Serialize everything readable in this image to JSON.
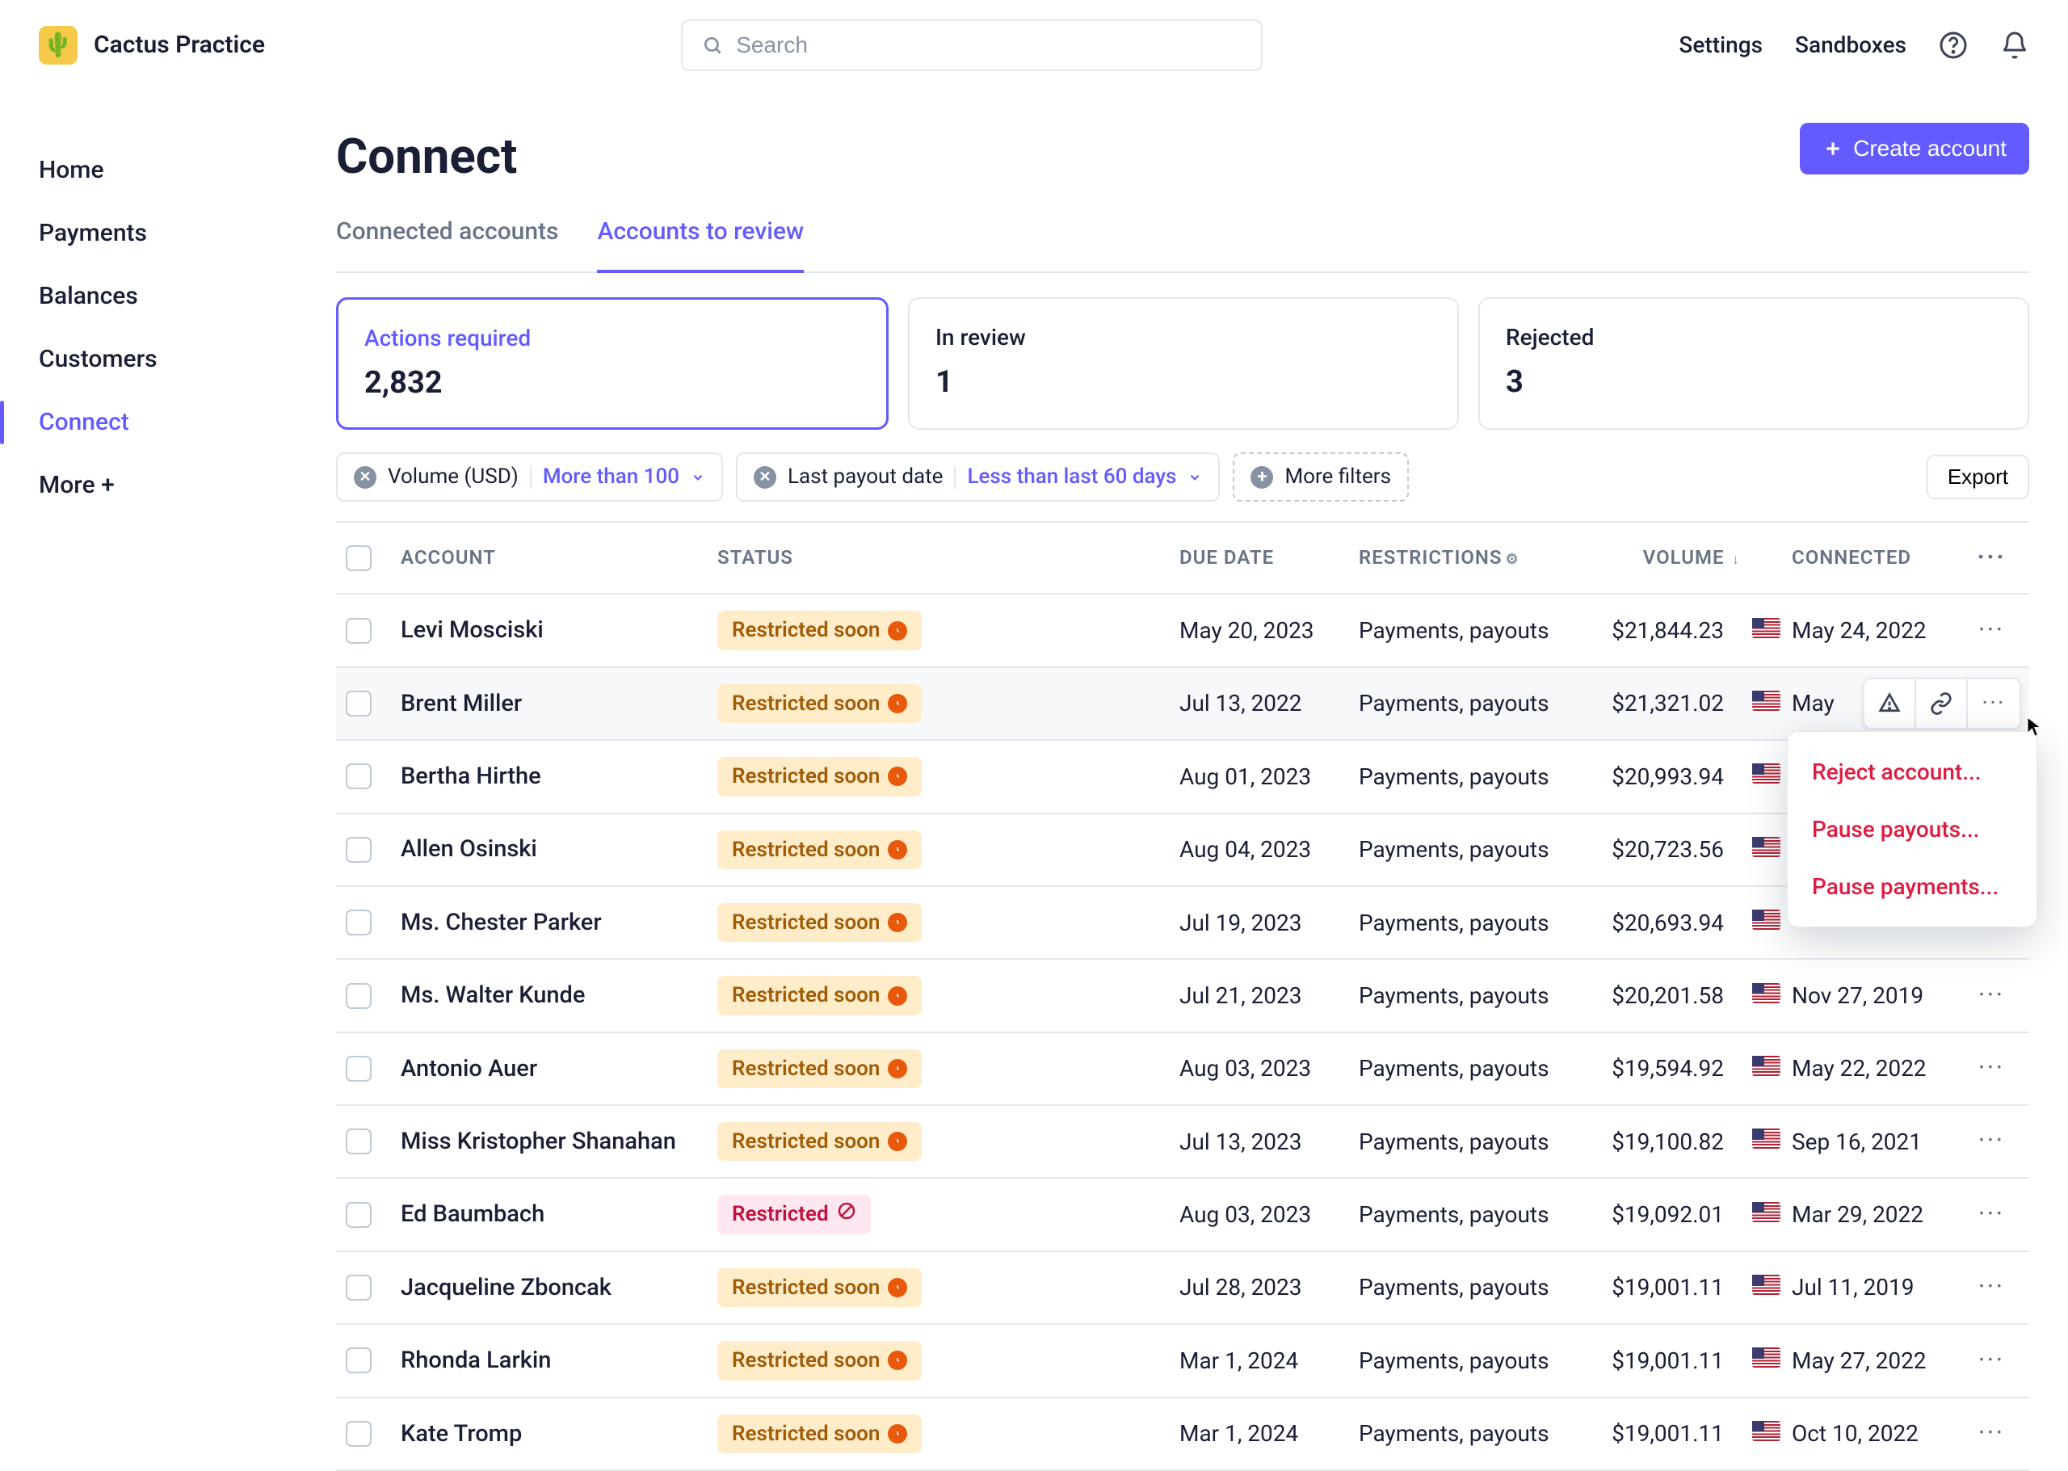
{
  "brand": "Cactus Practice",
  "search": {
    "placeholder": "Search"
  },
  "header_links": {
    "settings": "Settings",
    "sandboxes": "Sandboxes"
  },
  "sidebar": {
    "items": [
      {
        "label": "Home"
      },
      {
        "label": "Payments"
      },
      {
        "label": "Balances"
      },
      {
        "label": "Customers"
      },
      {
        "label": "Connect"
      },
      {
        "label": "More  +"
      }
    ],
    "active_index": 4
  },
  "page": {
    "title": "Connect",
    "create_button": "Create account"
  },
  "tabs": {
    "items": [
      {
        "label": "Connected accounts"
      },
      {
        "label": "Accounts to review"
      }
    ],
    "active_index": 1
  },
  "cards": {
    "items": [
      {
        "label": "Actions required",
        "value": "2,832"
      },
      {
        "label": "In review",
        "value": "1"
      },
      {
        "label": "Rejected",
        "value": "3"
      }
    ],
    "active_index": 0
  },
  "filters": {
    "chips": [
      {
        "label": "Volume (USD)",
        "value": "More than 100"
      },
      {
        "label": "Last payout date",
        "value": "Less than last 60 days"
      }
    ],
    "more": "More filters",
    "export": "Export"
  },
  "columns": {
    "account": "ACCOUNT",
    "status": "STATUS",
    "due_date": "DUE DATE",
    "restrictions": "RESTRICTIONS",
    "volume": "VOLUME",
    "connected": "CONNECTED"
  },
  "status_labels": {
    "soon": "Restricted soon",
    "restricted": "Restricted"
  },
  "rows": [
    {
      "name": "Levi Mosciski",
      "status": "soon",
      "due": "May 20, 2023",
      "restr": "Payments, payouts",
      "vol": "$21,844.23",
      "conn": "May 24, 2022"
    },
    {
      "name": "Brent Miller",
      "status": "soon",
      "due": "Jul 13, 2022",
      "restr": "Payments, payouts",
      "vol": "$21,321.02",
      "conn": "May"
    },
    {
      "name": "Bertha Hirthe",
      "status": "soon",
      "due": "Aug 01, 2023",
      "restr": "Payments, payouts",
      "vol": "$20,993.94",
      "conn": ""
    },
    {
      "name": "Allen Osinski",
      "status": "soon",
      "due": "Aug 04, 2023",
      "restr": "Payments, payouts",
      "vol": "$20,723.56",
      "conn": ""
    },
    {
      "name": "Ms. Chester Parker",
      "status": "soon",
      "due": "Jul 19, 2023",
      "restr": "Payments, payouts",
      "vol": "$20,693.94",
      "conn": ""
    },
    {
      "name": "Ms. Walter Kunde",
      "status": "soon",
      "due": "Jul 21, 2023",
      "restr": "Payments, payouts",
      "vol": "$20,201.58",
      "conn": "Nov 27, 2019"
    },
    {
      "name": "Antonio Auer",
      "status": "soon",
      "due": "Aug 03, 2023",
      "restr": "Payments, payouts",
      "vol": "$19,594.92",
      "conn": "May 22, 2022"
    },
    {
      "name": "Miss Kristopher Shanahan",
      "status": "soon",
      "due": "Jul 13, 2023",
      "restr": "Payments, payouts",
      "vol": "$19,100.82",
      "conn": "Sep 16, 2021"
    },
    {
      "name": "Ed Baumbach",
      "status": "restricted",
      "due": "Aug 03, 2023",
      "restr": "Payments, payouts",
      "vol": "$19,092.01",
      "conn": "Mar 29, 2022"
    },
    {
      "name": "Jacqueline Zboncak",
      "status": "soon",
      "due": "Jul 28, 2023",
      "restr": "Payments, payouts",
      "vol": "$19,001.11",
      "conn": "Jul 11, 2019"
    },
    {
      "name": "Rhonda Larkin",
      "status": "soon",
      "due": "Mar 1, 2024",
      "restr": "Payments, payouts",
      "vol": "$19,001.11",
      "conn": "May 27, 2022"
    },
    {
      "name": "Kate Tromp",
      "status": "soon",
      "due": "Mar 1, 2024",
      "restr": "Payments, payouts",
      "vol": "$19,001.11",
      "conn": "Oct 10, 2022"
    }
  ],
  "hover_row_index": 1,
  "dropdown": {
    "items": [
      "Reject account...",
      "Pause payouts...",
      "Pause payments..."
    ]
  }
}
